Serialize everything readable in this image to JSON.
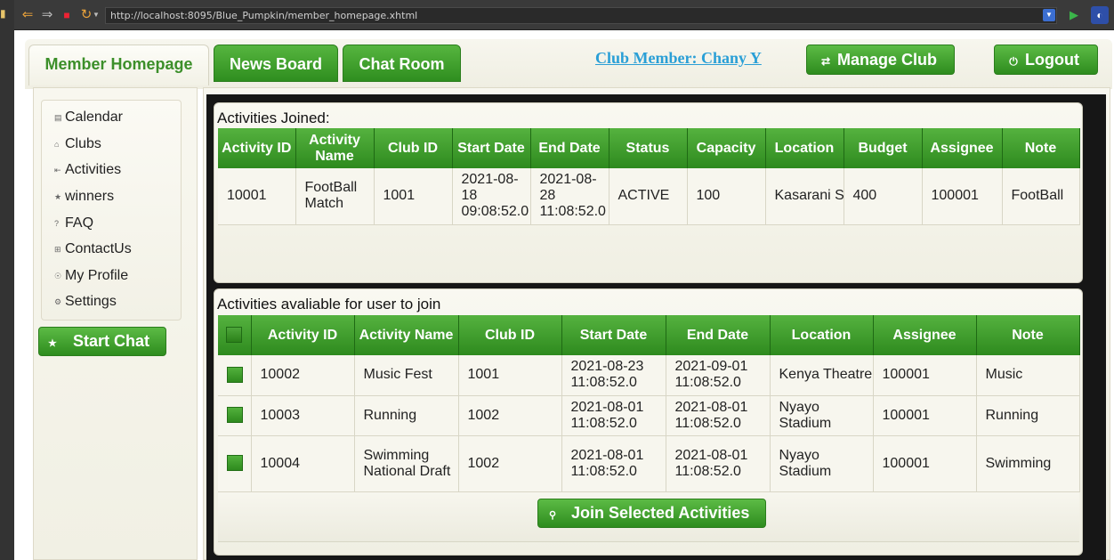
{
  "browser": {
    "url": "http://localhost:8095/Blue_Pumpkin/member_homepage.xhtml"
  },
  "tabs": {
    "member_homepage": "Member Homepage",
    "news_board": "News Board",
    "chat_room": "Chat Room"
  },
  "header": {
    "club_member": "Club Member: Chany Y",
    "manage_club": "Manage Club",
    "logout": "Logout"
  },
  "sidebar": {
    "items": [
      {
        "label": "Calendar",
        "icon": "calendar-icon"
      },
      {
        "label": "Clubs",
        "icon": "home-icon"
      },
      {
        "label": "Activities",
        "icon": "activity-icon"
      },
      {
        "label": "winners",
        "icon": "star-icon"
      },
      {
        "label": "FAQ",
        "icon": "question-icon"
      },
      {
        "label": "ContactUs",
        "icon": "contact-icon"
      },
      {
        "label": "My Profile",
        "icon": "user-icon"
      },
      {
        "label": "Settings",
        "icon": "gear-icon"
      }
    ],
    "start_chat": "Start Chat"
  },
  "joined": {
    "title": "Activities Joined:",
    "headers": [
      "Activity ID",
      "Activity Name",
      "Club ID",
      "Start Date",
      "End Date",
      "Status",
      "Capacity",
      "Location",
      "Budget",
      "Assignee",
      "Note"
    ],
    "rows": [
      [
        "10001",
        "FootBall Match",
        "1001",
        "2021-08-18 09:08:52.0",
        "2021-08-28 11:08:52.0",
        "ACTIVE",
        "100",
        "Kasarani Stadium,Nairobi",
        "400",
        "100001",
        "FootBall"
      ]
    ]
  },
  "available": {
    "title": "Activities avaliable for user to join",
    "headers": [
      "Activity ID",
      "Activity Name",
      "Club ID",
      "Start Date",
      "End Date",
      "Location",
      "Assignee",
      "Note"
    ],
    "rows": [
      [
        "10002",
        "Music Fest",
        "1001",
        "2021-08-23 11:08:52.0",
        "2021-09-01 11:08:52.0",
        "Kenya Theatre",
        "100001",
        "Music"
      ],
      [
        "10003",
        "Running",
        "1002",
        "2021-08-01 11:08:52.0",
        "2021-08-01 11:08:52.0",
        "Nyayo Stadium",
        "100001",
        "Running"
      ],
      [
        "10004",
        "Swimming National Draft",
        "1002",
        "2021-08-01 11:08:52.0",
        "2021-08-01 11:08:52.0",
        "Nyayo Stadium",
        "100001",
        "Swimming"
      ]
    ],
    "join_button": "Join Selected Activities"
  }
}
